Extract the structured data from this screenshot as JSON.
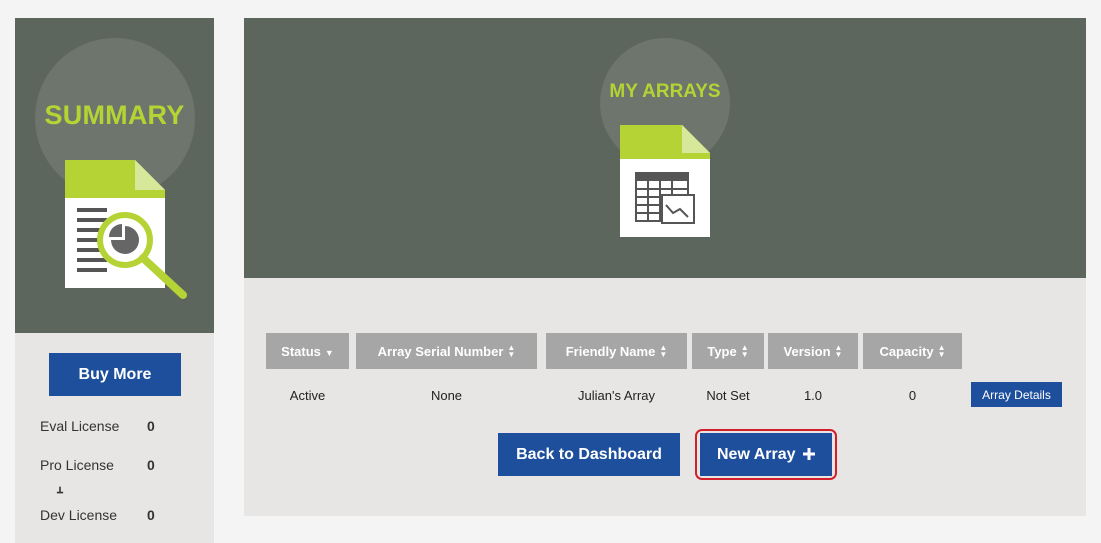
{
  "sidebar": {
    "title": "SUMMARY",
    "buy_more_label": "Buy More",
    "licenses": [
      {
        "label": "Eval License",
        "value": "0"
      },
      {
        "label": "Pro License",
        "value": "0"
      },
      {
        "label": "Dev License",
        "value": "0"
      }
    ],
    "icon": "document-magnifier-icon"
  },
  "main": {
    "title": "MY ARRAYS",
    "icon": "spreadsheet-chart-document-icon",
    "table": {
      "columns": [
        {
          "label": "Status",
          "sort_icon": "caret-down-icon"
        },
        {
          "label": "Array Serial Number",
          "sort_icon": "sort-icon"
        },
        {
          "label": "Friendly Name",
          "sort_icon": "sort-icon"
        },
        {
          "label": "Type",
          "sort_icon": "sort-icon"
        },
        {
          "label": "Version",
          "sort_icon": "sort-icon"
        },
        {
          "label": "Capacity",
          "sort_icon": "sort-icon"
        }
      ],
      "rows": [
        {
          "status": "Active",
          "serial": "None",
          "friendly_name": "Julian's Array",
          "type": "Not Set",
          "version": "1.0",
          "capacity": "0",
          "action_label": "Array Details"
        }
      ]
    },
    "back_label": "Back to Dashboard",
    "new_array_label": "New Array"
  },
  "colors": {
    "header_bg": "#5d665d",
    "accent_green": "#b5d334",
    "button_blue": "#1e4f9c",
    "highlight_red": "#d2202a"
  }
}
